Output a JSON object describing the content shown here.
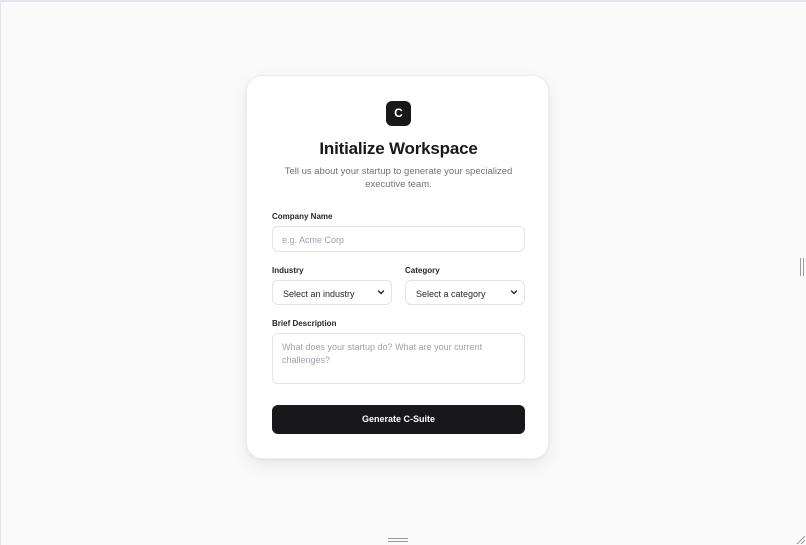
{
  "workspace": {
    "logo_letter": "C",
    "title": "Initialize Workspace",
    "subtitle": "Tell us about your startup to generate your specialized executive team."
  },
  "form": {
    "company_name": {
      "label": "Company Name",
      "placeholder": "e.g. Acme Corp"
    },
    "industry": {
      "label": "Industry",
      "selected": "Select an industry"
    },
    "category": {
      "label": "Category",
      "selected": "Select a category"
    },
    "description": {
      "label": "Brief Description",
      "placeholder": "What does your startup do? What are your current challenges?"
    },
    "submit_label": "Generate C-Suite"
  },
  "colors": {
    "page_background": "#fafafa",
    "card_background": "#ffffff",
    "primary": "#18181b",
    "muted_text": "#71717a",
    "placeholder_text": "#a1a1aa",
    "border": "#e4e4e7"
  },
  "icons": {
    "logo": "c-logo-icon",
    "select_arrow": "chevron-down-icon",
    "pane_handle_vertical": "drag-handle-vertical-icon",
    "pane_handle_horizontal": "drag-handle-horizontal-icon",
    "resize": "resize-corner-icon"
  }
}
